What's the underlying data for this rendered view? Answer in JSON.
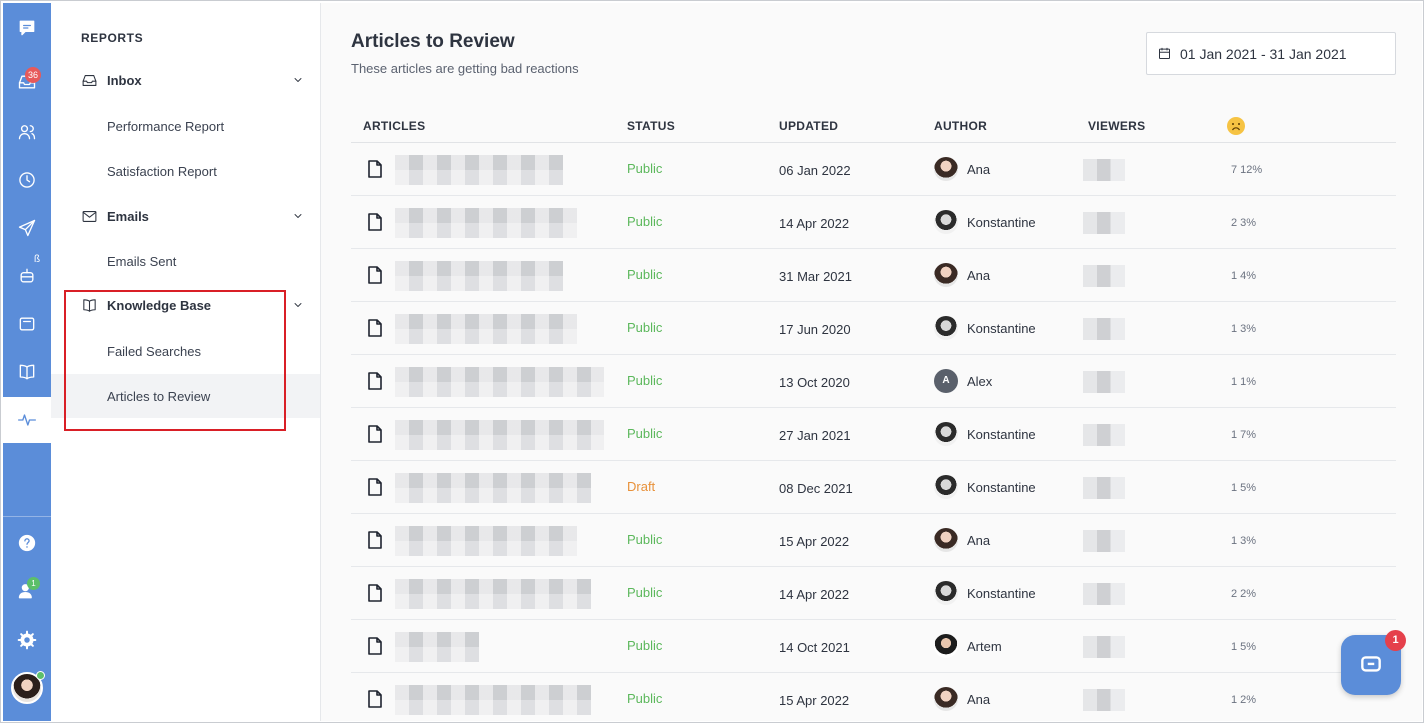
{
  "rail": {
    "inbox_badge": "36",
    "beta_mark": "ß",
    "agents_badge": "1"
  },
  "nav": {
    "title": "REPORTS",
    "groups": [
      {
        "label": "Inbox",
        "items": [
          "Performance Report",
          "Satisfaction Report"
        ]
      },
      {
        "label": "Emails",
        "items": [
          "Emails Sent"
        ]
      },
      {
        "label": "Knowledge Base",
        "items": [
          "Failed Searches",
          "Articles to Review"
        ]
      }
    ],
    "selected_item": "Articles to Review"
  },
  "header": {
    "title": "Articles to Review",
    "subtitle": "These articles are getting bad reactions",
    "date_range": "01 Jan 2021 - 31 Jan 2021"
  },
  "table": {
    "columns": [
      "ARTICLES",
      "STATUS",
      "UPDATED",
      "AUTHOR",
      "VIEWERS"
    ],
    "bad_reaction_icon": "sad-face-icon",
    "rows": [
      {
        "status": "Public",
        "updated": "06 Jan 2022",
        "author": "Ana",
        "avatar": "ana",
        "bad": "7  12%"
      },
      {
        "status": "Public",
        "updated": "14 Apr 2022",
        "author": "Konstantine",
        "avatar": "kon",
        "bad": "2  3%"
      },
      {
        "status": "Public",
        "updated": "31 Mar 2021",
        "author": "Ana",
        "avatar": "ana",
        "bad": "1  4%"
      },
      {
        "status": "Public",
        "updated": "17 Jun 2020",
        "author": "Konstantine",
        "avatar": "kon",
        "bad": "1  3%"
      },
      {
        "status": "Public",
        "updated": "13 Oct 2020",
        "author": "Alex",
        "avatar": "alex",
        "bad": "1  1%"
      },
      {
        "status": "Public",
        "updated": "27 Jan 2021",
        "author": "Konstantine",
        "avatar": "kon",
        "bad": "1  7%"
      },
      {
        "status": "Draft",
        "updated": "08 Dec 2021",
        "author": "Konstantine",
        "avatar": "kon",
        "bad": "1  5%"
      },
      {
        "status": "Public",
        "updated": "15 Apr 2022",
        "author": "Ana",
        "avatar": "ana",
        "bad": "1  3%"
      },
      {
        "status": "Public",
        "updated": "14 Apr 2022",
        "author": "Konstantine",
        "avatar": "kon",
        "bad": "2  2%"
      },
      {
        "status": "Public",
        "updated": "14 Oct 2021",
        "author": "Artem",
        "avatar": "art",
        "bad": "1  5%"
      },
      {
        "status": "Public",
        "updated": "15 Apr 2022",
        "author": "Ana",
        "avatar": "ana",
        "bad": "1  2%"
      }
    ]
  },
  "chat_widget": {
    "badge": "1"
  },
  "colors": {
    "rail_blue": "#5b8dd9",
    "public_green": "#5cb85c",
    "draft_orange": "#e8913a",
    "highlight_red": "#d91f26"
  }
}
